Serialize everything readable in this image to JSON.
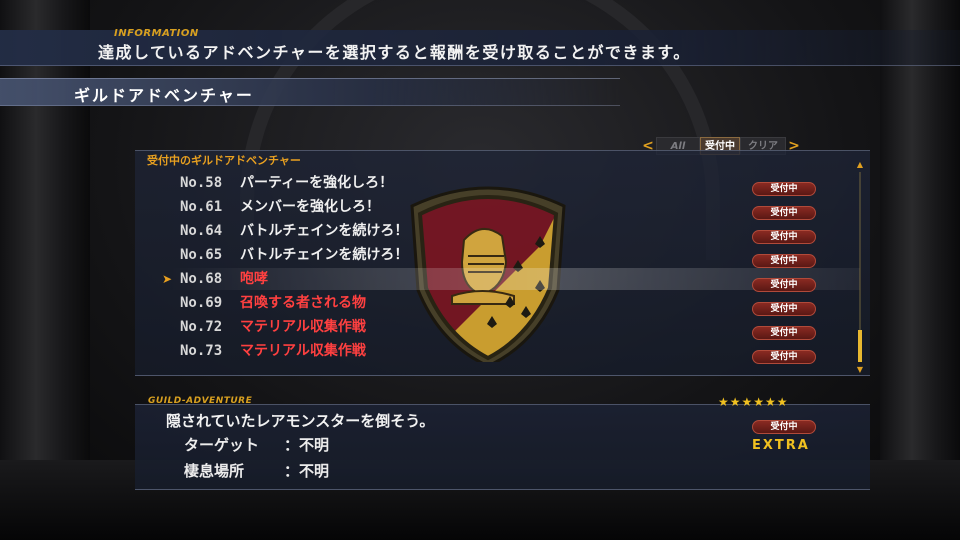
{
  "information": {
    "label": "INFORMATION",
    "text": "達成しているアドベンチャーを選択すると報酬を受け取ることができます。"
  },
  "section": {
    "title": "ギルドアドベンチャー"
  },
  "tabs": {
    "left_arrow": "<",
    "right_arrow": ">",
    "items": [
      {
        "label": "All",
        "active": false
      },
      {
        "label": "受付中",
        "active": true
      },
      {
        "label": "クリア",
        "active": false
      }
    ]
  },
  "list": {
    "header": "受付中のギルドアドベンチャー",
    "selected_index": 4,
    "rows": [
      {
        "num": "No.58",
        "title": "パーティーを強化しろ！",
        "highlight": false,
        "status": "受付中"
      },
      {
        "num": "No.61",
        "title": "メンバーを強化しろ！",
        "highlight": false,
        "status": "受付中"
      },
      {
        "num": "No.64",
        "title": "バトルチェインを続けろ！",
        "highlight": false,
        "status": "受付中"
      },
      {
        "num": "No.65",
        "title": "バトルチェインを続けろ！",
        "highlight": false,
        "status": "受付中"
      },
      {
        "num": "No.68",
        "title": "咆哮",
        "highlight": true,
        "status": "受付中"
      },
      {
        "num": "No.69",
        "title": "召喚する者される物",
        "highlight": true,
        "status": "受付中"
      },
      {
        "num": "No.72",
        "title": "マテリアル収集作戦",
        "highlight": true,
        "status": "受付中"
      },
      {
        "num": "No.73",
        "title": "マテリアル収集作戦",
        "highlight": true,
        "status": "受付中"
      }
    ]
  },
  "detail": {
    "label": "GUILD-ADVENTURE",
    "stars": "★★★★★★",
    "rating": 6,
    "description": "隠されていたレアモンスターを倒そう。",
    "status": "受付中",
    "target_key": "ターゲット",
    "target_value": "：不明",
    "habitat_key": "棲息場所",
    "habitat_value": "：不明",
    "rank": "EXTRA"
  },
  "colors": {
    "accent_gold": "#e8a020",
    "alert_red": "#ff4040",
    "badge_red": "#8a2a22"
  },
  "icons": {
    "cursor": "cursor-arrow-icon",
    "emblem": "knight-shield-emblem-icon"
  }
}
